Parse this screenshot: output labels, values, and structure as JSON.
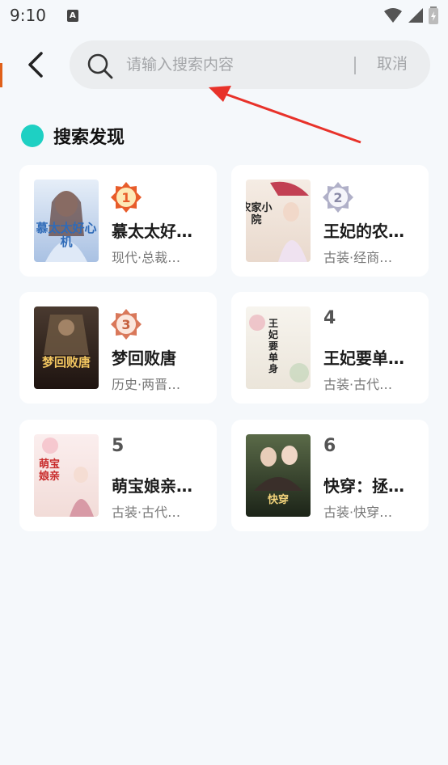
{
  "status_bar": {
    "time": "9:10",
    "notification_letter": "A"
  },
  "header": {
    "search_placeholder": "请输入搜索内容",
    "cancel_label": "取消"
  },
  "section": {
    "title": "搜索发现",
    "dot_color": "#1ed0c3"
  },
  "cards": [
    {
      "rank": "1",
      "title": "慕太太好…",
      "tags": "现代·总裁…",
      "cover_text": "慕太太好心机",
      "cover_bg": "#c9d8ec",
      "badge_color": "#e85c2a"
    },
    {
      "rank": "2",
      "title": "王妃的农…",
      "tags": "古装·经商…",
      "cover_text": "农家小院",
      "cover_bg": "#efe4dc",
      "badge_color": "#b0b0c8"
    },
    {
      "rank": "3",
      "title": "梦回败唐",
      "tags": "历史·两晋…",
      "cover_text": "梦回败唐",
      "cover_bg": "#3a2a22",
      "badge_color": "#d9785a"
    },
    {
      "rank": "4",
      "title": "王妃要单…",
      "tags": "古装·古代…",
      "cover_text": "王妃要单身",
      "cover_bg": "#f2efe8",
      "badge_color": ""
    },
    {
      "rank": "5",
      "title": "萌宝娘亲…",
      "tags": "古装·古代…",
      "cover_text": "萌宝娘亲",
      "cover_bg": "#f7e7e3",
      "badge_color": ""
    },
    {
      "rank": "6",
      "title": "快穿：拯…",
      "tags": "古装·快穿…",
      "cover_text": "快穿",
      "cover_bg": "#2d3526",
      "badge_color": ""
    }
  ]
}
